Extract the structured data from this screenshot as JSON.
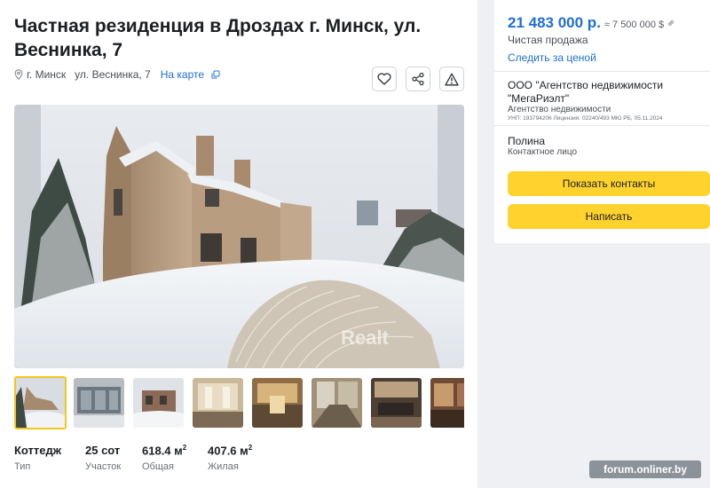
{
  "listing": {
    "title": "Частная резиденция в Дроздах г. Минск, ул. Веснинка, 7",
    "address": {
      "city": "г. Минск",
      "street": "ул. Веснинка, 7",
      "map_link": "На карте"
    },
    "actions": {
      "favorite_icon": "heart-icon",
      "share_icon": "share-icon",
      "report_icon": "warning-icon"
    },
    "photo_watermark": "Realt",
    "thumbnails_count": 8,
    "active_thumbnail": 1,
    "specs": [
      {
        "value": "Коттедж",
        "unit": "",
        "label": "Тип"
      },
      {
        "value": "25 сот",
        "unit": "",
        "label": "Участок"
      },
      {
        "value": "618.4 м",
        "unit": "2",
        "label": "Общая"
      },
      {
        "value": "407.6 м",
        "unit": "2",
        "label": "Жилая"
      }
    ]
  },
  "sidebar": {
    "price_byn": "21 483 000 р.",
    "price_usd": "≈ 7 500 000 $",
    "sale_type": "Чистая продажа",
    "follow_price": "Следить за ценой",
    "agency": {
      "name": "ООО \"Агентство недвижимости \"МегаРиэлт\"",
      "type": "Агентство недвижимости",
      "license": "УНП: 193794206 Лицензия: 02240/493 МЮ РБ, 05.11.2024"
    },
    "contact": {
      "name": "Полина",
      "role": "Контактное лицо"
    },
    "buttons": {
      "show_contacts": "Показать контакты",
      "write": "Написать"
    }
  },
  "watermark": "forum.onliner.by",
  "colors": {
    "accent_blue": "#1f6fd1",
    "button_yellow": "#ffd22e",
    "page_bg": "#eef0f3"
  }
}
